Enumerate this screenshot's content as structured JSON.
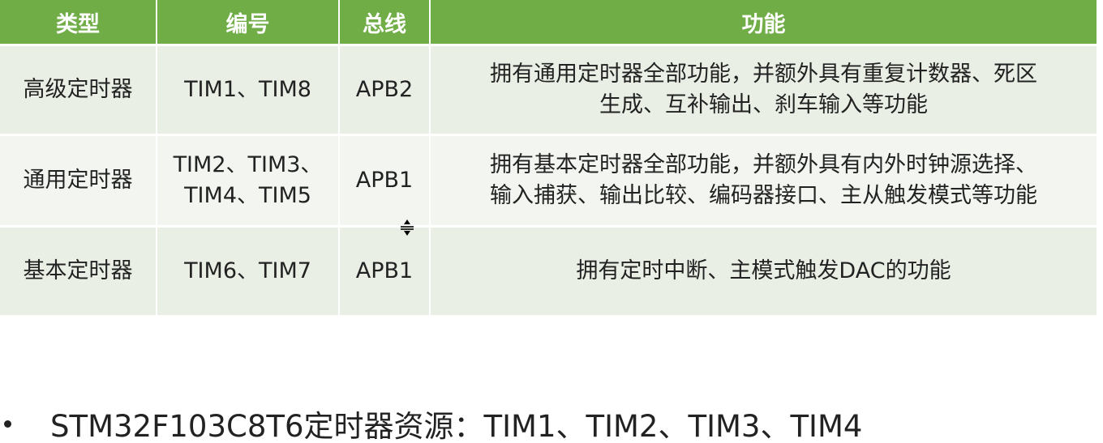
{
  "table": {
    "headers": [
      "类型",
      "编号",
      "总线",
      "功能"
    ],
    "rows": [
      {
        "type": "高级定时器",
        "number_lines": [
          "TIM1、TIM8"
        ],
        "bus": "APB2",
        "function_lines": [
          "拥有通用定时器全部功能，并额外具有重复计数器、死区",
          "生成、互补输出、刹车输入等功能"
        ]
      },
      {
        "type": "通用定时器",
        "number_lines": [
          "TIM2、TIM3、",
          "TIM4、TIM5"
        ],
        "bus": "APB1",
        "function_lines": [
          "拥有基本定时器全部功能，并额外具有内外时钟源选择、",
          "输入捕获、输出比较、编码器接口、主从触发模式等功能"
        ]
      },
      {
        "type": "基本定时器",
        "number_lines": [
          "TIM6、TIM7"
        ],
        "bus": "APB1",
        "function_lines": [
          "拥有定时中断、主模式触发DAC的功能"
        ]
      }
    ]
  },
  "bullet": {
    "text": "STM32F103C8T6定时器资源：TIM1、TIM2、TIM3、TIM4"
  },
  "colors": {
    "header_bg": "#70ad47",
    "row_bg_dark": "#e9efe5",
    "row_bg_light": "#f3f6f0"
  },
  "icons": {
    "cursor": "row-resize-cursor-icon"
  }
}
